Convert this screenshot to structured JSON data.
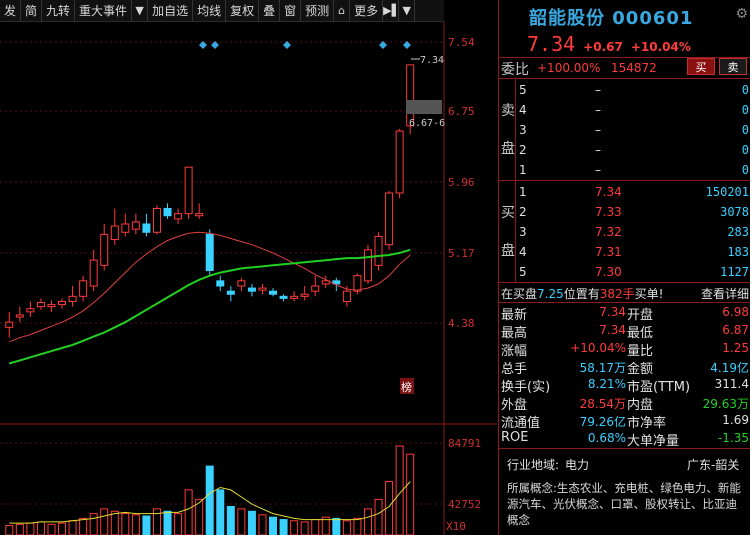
{
  "toolbar": {
    "items": [
      "发",
      "简",
      "九转",
      "重大事件",
      "▼",
      "加自选",
      "均线",
      "复权",
      "叠",
      "窗",
      "预测",
      "⌂",
      "更多",
      "▶▌",
      "▼"
    ]
  },
  "price_axis": {
    "labels": [
      "7.54",
      "6.75",
      "5.96",
      "5.17",
      "4.38"
    ],
    "tag_top": "7.34",
    "tag_range": "6.67-6"
  },
  "volume_axis": {
    "labels": [
      "84791",
      "42752",
      "X10"
    ]
  },
  "side_tag": "榜",
  "chart_data": {
    "type": "candlestick",
    "price_range": [
      4.0,
      7.6
    ],
    "candles": [
      {
        "o": 4.8,
        "c": 4.85,
        "h": 4.95,
        "l": 4.7
      },
      {
        "o": 4.9,
        "c": 4.92,
        "h": 5.0,
        "l": 4.85
      },
      {
        "o": 4.95,
        "c": 4.98,
        "h": 5.05,
        "l": 4.9
      },
      {
        "o": 5.0,
        "c": 5.04,
        "h": 5.08,
        "l": 4.97
      },
      {
        "o": 5.0,
        "c": 5.02,
        "h": 5.06,
        "l": 4.95
      },
      {
        "o": 5.02,
        "c": 5.05,
        "h": 5.08,
        "l": 4.98
      },
      {
        "o": 5.05,
        "c": 5.1,
        "h": 5.2,
        "l": 5.0
      },
      {
        "o": 5.1,
        "c": 5.25,
        "h": 5.3,
        "l": 5.05
      },
      {
        "o": 5.2,
        "c": 5.45,
        "h": 5.55,
        "l": 5.15
      },
      {
        "o": 5.4,
        "c": 5.7,
        "h": 5.8,
        "l": 5.35
      },
      {
        "o": 5.65,
        "c": 5.78,
        "h": 5.95,
        "l": 5.6
      },
      {
        "o": 5.72,
        "c": 5.8,
        "h": 5.9,
        "l": 5.68
      },
      {
        "o": 5.75,
        "c": 5.82,
        "h": 5.9,
        "l": 5.7
      },
      {
        "o": 5.8,
        "c": 5.72,
        "h": 5.9,
        "l": 5.68
      },
      {
        "o": 5.72,
        "c": 5.95,
        "h": 5.98,
        "l": 5.7
      },
      {
        "o": 5.95,
        "c": 5.88,
        "h": 6.0,
        "l": 5.85
      },
      {
        "o": 5.85,
        "c": 5.9,
        "h": 5.95,
        "l": 5.8
      },
      {
        "o": 5.9,
        "c": 6.35,
        "h": 6.35,
        "l": 5.85
      },
      {
        "o": 5.88,
        "c": 5.9,
        "h": 6.0,
        "l": 5.85
      },
      {
        "o": 5.7,
        "c": 5.35,
        "h": 5.75,
        "l": 5.3
      },
      {
        "o": 5.25,
        "c": 5.2,
        "h": 5.3,
        "l": 5.15
      },
      {
        "o": 5.15,
        "c": 5.12,
        "h": 5.2,
        "l": 5.05
      },
      {
        "o": 5.2,
        "c": 5.25,
        "h": 5.28,
        "l": 5.15
      },
      {
        "o": 5.18,
        "c": 5.15,
        "h": 5.22,
        "l": 5.1
      },
      {
        "o": 5.16,
        "c": 5.18,
        "h": 5.22,
        "l": 5.12
      },
      {
        "o": 5.15,
        "c": 5.12,
        "h": 5.18,
        "l": 5.1
      },
      {
        "o": 5.1,
        "c": 5.08,
        "h": 5.12,
        "l": 5.05
      },
      {
        "o": 5.08,
        "c": 5.1,
        "h": 5.15,
        "l": 5.05
      },
      {
        "o": 5.1,
        "c": 5.12,
        "h": 5.2,
        "l": 5.06
      },
      {
        "o": 5.15,
        "c": 5.2,
        "h": 5.3,
        "l": 5.1
      },
      {
        "o": 5.22,
        "c": 5.25,
        "h": 5.3,
        "l": 5.18
      },
      {
        "o": 5.25,
        "c": 5.22,
        "h": 5.28,
        "l": 5.15
      },
      {
        "o": 5.05,
        "c": 5.15,
        "h": 5.2,
        "l": 5.0
      },
      {
        "o": 5.15,
        "c": 5.3,
        "h": 5.32,
        "l": 5.12
      },
      {
        "o": 5.25,
        "c": 5.55,
        "h": 5.6,
        "l": 5.22
      },
      {
        "o": 5.4,
        "c": 5.68,
        "h": 5.72,
        "l": 5.35
      },
      {
        "o": 5.6,
        "c": 6.1,
        "h": 6.12,
        "l": 5.55
      },
      {
        "o": 6.1,
        "c": 6.7,
        "h": 6.72,
        "l": 6.05
      },
      {
        "o": 6.75,
        "c": 7.34,
        "h": 7.34,
        "l": 6.67
      }
    ],
    "ma_red": [
      4.66,
      4.7,
      4.73,
      4.77,
      4.81,
      4.85,
      4.9,
      4.96,
      5.04,
      5.13,
      5.23,
      5.33,
      5.43,
      5.51,
      5.58,
      5.64,
      5.68,
      5.71,
      5.72,
      5.71,
      5.69,
      5.66,
      5.63,
      5.6,
      5.56,
      5.52,
      5.47,
      5.42,
      5.37,
      5.31,
      5.26,
      5.21,
      5.17,
      5.16,
      5.18,
      5.22,
      5.3,
      5.41,
      5.5
    ],
    "ma_green": [
      4.45,
      4.48,
      4.51,
      4.54,
      4.57,
      4.6,
      4.63,
      4.67,
      4.71,
      4.75,
      4.8,
      4.85,
      4.91,
      4.97,
      5.03,
      5.09,
      5.15,
      5.21,
      5.26,
      5.3,
      5.33,
      5.35,
      5.37,
      5.38,
      5.39,
      5.4,
      5.41,
      5.42,
      5.43,
      5.44,
      5.45,
      5.46,
      5.47,
      5.47,
      5.48,
      5.49,
      5.5,
      5.52,
      5.55
    ],
    "volume": [
      8,
      9,
      10,
      11,
      9,
      10,
      12,
      14,
      18,
      22,
      20,
      18,
      17,
      16,
      22,
      20,
      18,
      38,
      30,
      58,
      38,
      24,
      22,
      20,
      17,
      15,
      13,
      12,
      11,
      13,
      15,
      14,
      12,
      14,
      22,
      30,
      45,
      75,
      68
    ],
    "volume_range": [
      0,
      84791
    ],
    "volume_ma": [
      10,
      10,
      10,
      11,
      11,
      11,
      12,
      13,
      14,
      16,
      18,
      19,
      18,
      18,
      18,
      19,
      19,
      22,
      27,
      35,
      40,
      38,
      32,
      26,
      22,
      18,
      16,
      14,
      13,
      13,
      13,
      13,
      13,
      13,
      15,
      18,
      24,
      35,
      45
    ]
  },
  "right": {
    "name": "韶能股份",
    "code": "000601",
    "price": "7.34",
    "change": "+0.67",
    "change_pct": "+10.04%",
    "weibi_label": "委比",
    "weibi_pct": "+100.00%",
    "weibi_val": "154872",
    "btn_buy": "买",
    "btn_sell": "卖",
    "sell_label": [
      "卖",
      "盘"
    ],
    "buy_label": [
      "买",
      "盘"
    ],
    "sell_orders": [
      {
        "lvl": "5",
        "price": "–",
        "vol": "0"
      },
      {
        "lvl": "4",
        "price": "–",
        "vol": "0"
      },
      {
        "lvl": "3",
        "price": "–",
        "vol": "0"
      },
      {
        "lvl": "2",
        "price": "–",
        "vol": "0"
      },
      {
        "lvl": "1",
        "price": "–",
        "vol": "0"
      }
    ],
    "buy_orders": [
      {
        "lvl": "1",
        "price": "7.34",
        "vol": "150201"
      },
      {
        "lvl": "2",
        "price": "7.33",
        "vol": "3078"
      },
      {
        "lvl": "3",
        "price": "7.32",
        "vol": "283"
      },
      {
        "lvl": "4",
        "price": "7.31",
        "vol": "183"
      },
      {
        "lvl": "5",
        "price": "7.30",
        "vol": "1127"
      }
    ],
    "notice_a": "在买盘",
    "notice_b": "7.25",
    "notice_c": "位置有",
    "notice_d": "382手",
    "notice_e": "买单!",
    "detail_link": "查看详细",
    "stats_left": [
      {
        "label": "最新",
        "value": "7.34",
        "cls": "red"
      },
      {
        "label": "最高",
        "value": "7.34",
        "cls": "red"
      },
      {
        "label": "涨幅",
        "value": "+10.04%",
        "cls": "red"
      },
      {
        "label": "总手",
        "value": "58.17万",
        "cls": "cyan"
      },
      {
        "label": "换手(实)",
        "value": "8.21%",
        "cls": "cyan"
      },
      {
        "label": "外盘",
        "value": "28.54万",
        "cls": "red"
      },
      {
        "label": "流通值",
        "value": "79.26亿",
        "cls": "cyan"
      },
      {
        "label": "ROE",
        "value": "0.68%",
        "cls": "cyan"
      }
    ],
    "stats_right": [
      {
        "label": "开盘",
        "value": "6.98",
        "cls": "red"
      },
      {
        "label": "最低",
        "value": "6.87",
        "cls": "red"
      },
      {
        "label": "量比",
        "value": "1.25",
        "cls": "red"
      },
      {
        "label": "金额",
        "value": "4.19亿",
        "cls": "cyan"
      },
      {
        "label": "市盈(TTM)",
        "value": "311.4",
        "cls": "white"
      },
      {
        "label": "内盘",
        "value": "29.63万",
        "cls": "green"
      },
      {
        "label": "市净率",
        "value": "1.69",
        "cls": "white"
      },
      {
        "label": "大单净量",
        "value": "-1.35",
        "cls": "green"
      }
    ],
    "industry_label": "行业地域:",
    "industry_value": "电力",
    "region": "广东-韶关",
    "concept_label": "所属概念:",
    "concept_value": "生态农业、充电桩、绿色电力、新能源汽车、光伏概念、口罩、股权转让、比亚迪概念"
  }
}
